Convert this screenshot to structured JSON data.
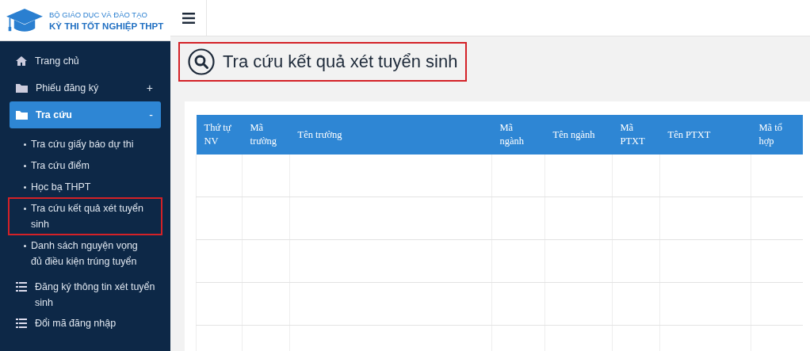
{
  "logo": {
    "line_1": "BỘ GIÁO DỤC VÀ ĐÀO TẠO",
    "line_2": "KỲ THI TỐT NGHIỆP THPT"
  },
  "sidebar": {
    "items": [
      {
        "kind": "home",
        "label": "Trang chủ",
        "selected": false
      },
      {
        "kind": "folder",
        "label": "Phiếu đăng ký",
        "toggle": "+",
        "selected": false
      },
      {
        "kind": "folder",
        "label": "Tra cứu",
        "toggle": "-",
        "selected": true,
        "children": [
          {
            "label": "Tra cứu giấy báo dự thi",
            "selected": false,
            "highlighted": false
          },
          {
            "label": "Tra cứu điểm",
            "selected": false,
            "highlighted": false
          },
          {
            "label": "Học bạ THPT",
            "selected": false,
            "highlighted": false
          },
          {
            "label": "Tra cứu kết quả xét tuyển sinh",
            "selected": false,
            "highlighted": true
          },
          {
            "label": "Danh sách nguyện vọng đủ điều kiện trúng tuyển",
            "selected": false,
            "highlighted": false
          }
        ]
      },
      {
        "kind": "list",
        "label": "Đăng ký thông tin xét tuyển sinh",
        "selected": false
      },
      {
        "kind": "list",
        "label": "Đổi mã đăng nhập",
        "selected": false
      }
    ]
  },
  "page_title": {
    "text": "Tra cứu kết quả xét tuyển sinh",
    "highlighted": true
  },
  "table": {
    "columns": [
      "Thứ tự NV",
      "Mã trường",
      "Tên trường",
      "Mã ngành",
      "Tên ngành",
      "Mã PTXT",
      "Tên PTXT",
      "Mã tổ hợp"
    ]
  }
}
